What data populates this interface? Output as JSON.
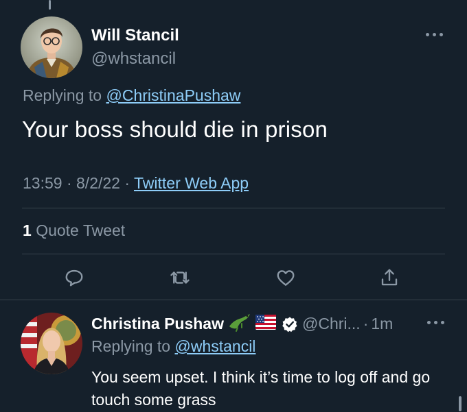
{
  "main_tweet": {
    "author_name": "Will Stancil",
    "author_handle": "@whstancil",
    "replying_prefix": "Replying to",
    "replying_to": "@ChristinaPushaw",
    "text": "Your boss should die in prison",
    "time": "13:59",
    "date": "8/2/22",
    "separator": "·",
    "source": "Twitter Web App",
    "quote_count": "1",
    "quote_label": "Quote Tweet",
    "actions": {
      "reply_icon": "reply-icon",
      "retweet_icon": "retweet-icon",
      "like_icon": "heart-icon",
      "share_icon": "share-icon"
    }
  },
  "reply_tweet": {
    "author_name": "Christina Pushaw",
    "badge_emojis": [
      "alligator-icon",
      "us-flag-icon"
    ],
    "verified": true,
    "handle_truncated": "@Chri...",
    "separator": "·",
    "time_ago": "1m",
    "replying_prefix": "Replying to",
    "replying_to": "@whstancil",
    "text": "You seem upset. I think it’s time to log off and go touch some grass"
  },
  "colors": {
    "background": "#15202b",
    "primary_text": "#ffffff",
    "secondary_text": "#8b98a5",
    "link": "#8ecdf8",
    "divider": "#38444d"
  }
}
